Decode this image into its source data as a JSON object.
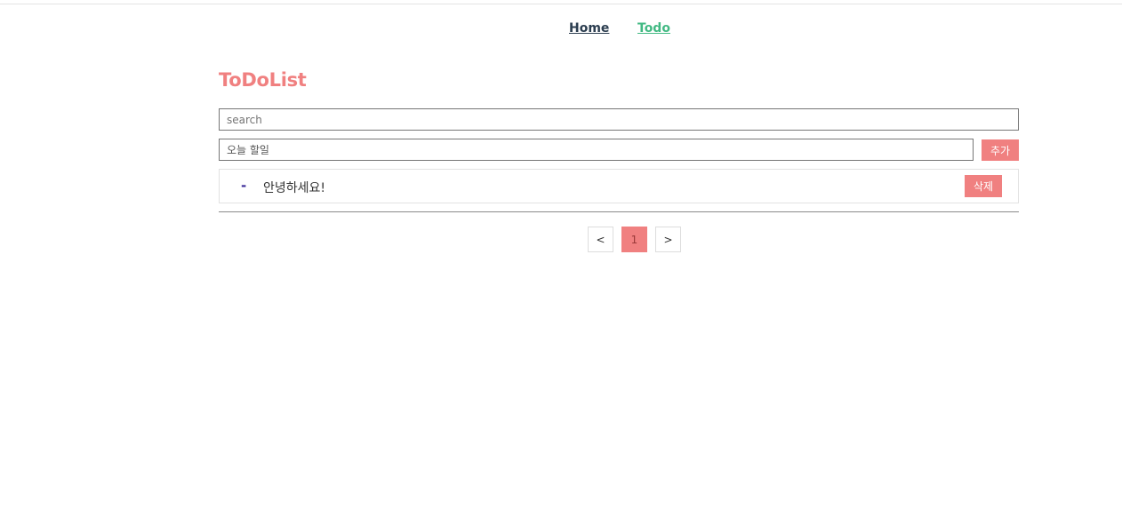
{
  "nav": {
    "home_label": "Home",
    "todo_label": "Todo"
  },
  "page": {
    "title": "ToDoList"
  },
  "search": {
    "placeholder": "search",
    "value": ""
  },
  "new_todo": {
    "placeholder": "오늘 할일",
    "value": "",
    "add_label": "추가"
  },
  "todos": [
    {
      "marker": "-",
      "text": "안녕하세요!",
      "delete_label": "삭제"
    }
  ],
  "pagination": {
    "prev_label": "<",
    "current_page": "1",
    "next_label": ">"
  },
  "colors": {
    "accent": "#f08080",
    "nav_active": "#42b983",
    "nav_default": "#2c3e50",
    "marker": "#3d2d9a"
  }
}
